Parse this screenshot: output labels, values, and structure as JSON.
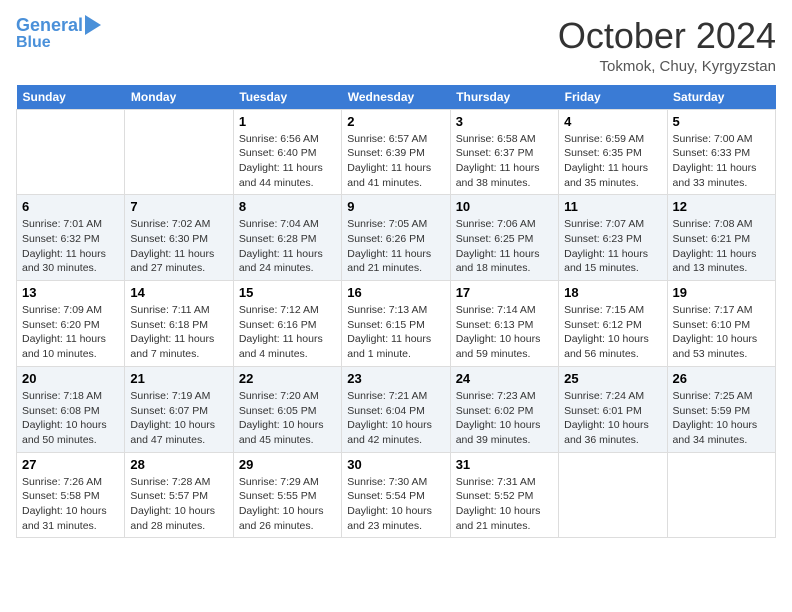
{
  "header": {
    "logo_line1": "General",
    "logo_line2": "Blue",
    "month_title": "October 2024",
    "location": "Tokmok, Chuy, Kyrgyzstan"
  },
  "days_of_week": [
    "Sunday",
    "Monday",
    "Tuesday",
    "Wednesday",
    "Thursday",
    "Friday",
    "Saturday"
  ],
  "weeks": [
    [
      {
        "day": "",
        "content": ""
      },
      {
        "day": "",
        "content": ""
      },
      {
        "day": "1",
        "content": "Sunrise: 6:56 AM\nSunset: 6:40 PM\nDaylight: 11 hours and 44 minutes."
      },
      {
        "day": "2",
        "content": "Sunrise: 6:57 AM\nSunset: 6:39 PM\nDaylight: 11 hours and 41 minutes."
      },
      {
        "day": "3",
        "content": "Sunrise: 6:58 AM\nSunset: 6:37 PM\nDaylight: 11 hours and 38 minutes."
      },
      {
        "day": "4",
        "content": "Sunrise: 6:59 AM\nSunset: 6:35 PM\nDaylight: 11 hours and 35 minutes."
      },
      {
        "day": "5",
        "content": "Sunrise: 7:00 AM\nSunset: 6:33 PM\nDaylight: 11 hours and 33 minutes."
      }
    ],
    [
      {
        "day": "6",
        "content": "Sunrise: 7:01 AM\nSunset: 6:32 PM\nDaylight: 11 hours and 30 minutes."
      },
      {
        "day": "7",
        "content": "Sunrise: 7:02 AM\nSunset: 6:30 PM\nDaylight: 11 hours and 27 minutes."
      },
      {
        "day": "8",
        "content": "Sunrise: 7:04 AM\nSunset: 6:28 PM\nDaylight: 11 hours and 24 minutes."
      },
      {
        "day": "9",
        "content": "Sunrise: 7:05 AM\nSunset: 6:26 PM\nDaylight: 11 hours and 21 minutes."
      },
      {
        "day": "10",
        "content": "Sunrise: 7:06 AM\nSunset: 6:25 PM\nDaylight: 11 hours and 18 minutes."
      },
      {
        "day": "11",
        "content": "Sunrise: 7:07 AM\nSunset: 6:23 PM\nDaylight: 11 hours and 15 minutes."
      },
      {
        "day": "12",
        "content": "Sunrise: 7:08 AM\nSunset: 6:21 PM\nDaylight: 11 hours and 13 minutes."
      }
    ],
    [
      {
        "day": "13",
        "content": "Sunrise: 7:09 AM\nSunset: 6:20 PM\nDaylight: 11 hours and 10 minutes."
      },
      {
        "day": "14",
        "content": "Sunrise: 7:11 AM\nSunset: 6:18 PM\nDaylight: 11 hours and 7 minutes."
      },
      {
        "day": "15",
        "content": "Sunrise: 7:12 AM\nSunset: 6:16 PM\nDaylight: 11 hours and 4 minutes."
      },
      {
        "day": "16",
        "content": "Sunrise: 7:13 AM\nSunset: 6:15 PM\nDaylight: 11 hours and 1 minute."
      },
      {
        "day": "17",
        "content": "Sunrise: 7:14 AM\nSunset: 6:13 PM\nDaylight: 10 hours and 59 minutes."
      },
      {
        "day": "18",
        "content": "Sunrise: 7:15 AM\nSunset: 6:12 PM\nDaylight: 10 hours and 56 minutes."
      },
      {
        "day": "19",
        "content": "Sunrise: 7:17 AM\nSunset: 6:10 PM\nDaylight: 10 hours and 53 minutes."
      }
    ],
    [
      {
        "day": "20",
        "content": "Sunrise: 7:18 AM\nSunset: 6:08 PM\nDaylight: 10 hours and 50 minutes."
      },
      {
        "day": "21",
        "content": "Sunrise: 7:19 AM\nSunset: 6:07 PM\nDaylight: 10 hours and 47 minutes."
      },
      {
        "day": "22",
        "content": "Sunrise: 7:20 AM\nSunset: 6:05 PM\nDaylight: 10 hours and 45 minutes."
      },
      {
        "day": "23",
        "content": "Sunrise: 7:21 AM\nSunset: 6:04 PM\nDaylight: 10 hours and 42 minutes."
      },
      {
        "day": "24",
        "content": "Sunrise: 7:23 AM\nSunset: 6:02 PM\nDaylight: 10 hours and 39 minutes."
      },
      {
        "day": "25",
        "content": "Sunrise: 7:24 AM\nSunset: 6:01 PM\nDaylight: 10 hours and 36 minutes."
      },
      {
        "day": "26",
        "content": "Sunrise: 7:25 AM\nSunset: 5:59 PM\nDaylight: 10 hours and 34 minutes."
      }
    ],
    [
      {
        "day": "27",
        "content": "Sunrise: 7:26 AM\nSunset: 5:58 PM\nDaylight: 10 hours and 31 minutes."
      },
      {
        "day": "28",
        "content": "Sunrise: 7:28 AM\nSunset: 5:57 PM\nDaylight: 10 hours and 28 minutes."
      },
      {
        "day": "29",
        "content": "Sunrise: 7:29 AM\nSunset: 5:55 PM\nDaylight: 10 hours and 26 minutes."
      },
      {
        "day": "30",
        "content": "Sunrise: 7:30 AM\nSunset: 5:54 PM\nDaylight: 10 hours and 23 minutes."
      },
      {
        "day": "31",
        "content": "Sunrise: 7:31 AM\nSunset: 5:52 PM\nDaylight: 10 hours and 21 minutes."
      },
      {
        "day": "",
        "content": ""
      },
      {
        "day": "",
        "content": ""
      }
    ]
  ]
}
